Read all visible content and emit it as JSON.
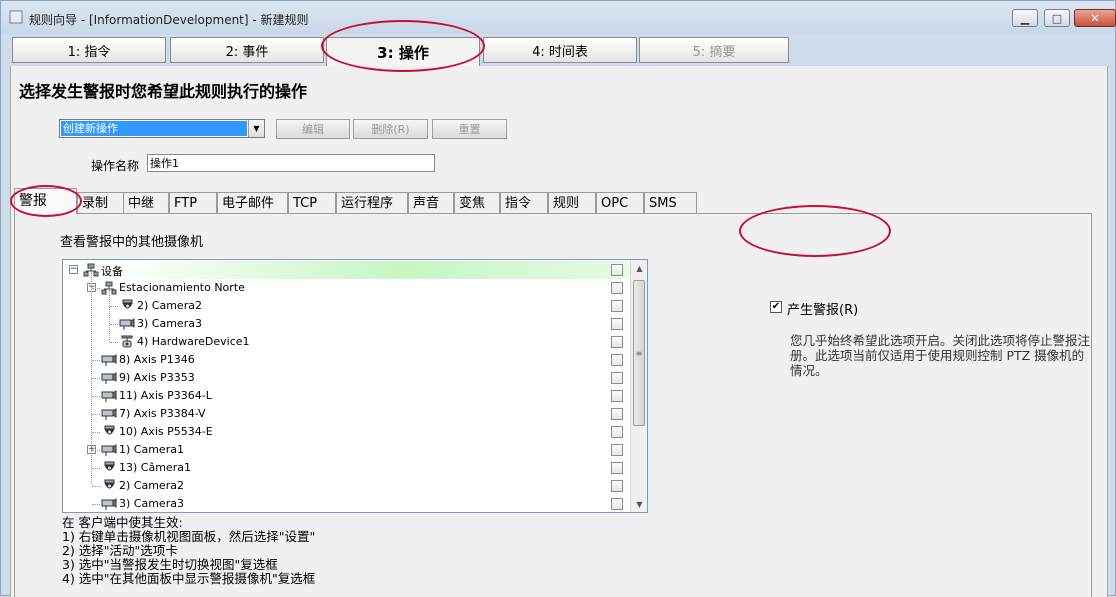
{
  "window": {
    "title": "规则向导 - [InformationDevelopment] - 新建规则",
    "minimize": "▁",
    "maximize": "□",
    "close": "✕"
  },
  "steps": [
    {
      "label": "1: 指令",
      "state": "normal"
    },
    {
      "label": "2: 事件",
      "state": "normal"
    },
    {
      "label": "3: 操作",
      "state": "active"
    },
    {
      "label": "4: 时间表",
      "state": "normal"
    },
    {
      "label": "5: 摘要",
      "state": "disabled"
    }
  ],
  "heading": "选择发生警报时您希望此规则执行的操作",
  "action_select": {
    "value": "创建新操作",
    "arrow": "▼"
  },
  "buttons": {
    "edit": "编辑",
    "delete": "删除(R)",
    "reset": "重置"
  },
  "action_name": {
    "label": "操作名称",
    "value": "操作1"
  },
  "subtabs": [
    "警报",
    "录制",
    "中继",
    "FTP",
    "电子邮件",
    "TCP",
    "运行程序",
    "声音",
    "变焦",
    "指令",
    "规则",
    "OPC",
    "SMS"
  ],
  "panel_title": "查看警报中的其他摄像机",
  "tree": [
    {
      "label": "设备",
      "level": 0,
      "icon": "network-devices-icon",
      "expander": "−"
    },
    {
      "label": "Estacionamiento Norte",
      "level": 1,
      "icon": "network-devices-icon",
      "expander": "−"
    },
    {
      "label": "2) Camera2",
      "level": 2,
      "icon": "dome-camera-icon"
    },
    {
      "label": "3) Camera3",
      "level": 2,
      "icon": "box-camera-icon"
    },
    {
      "label": "4) HardwareDevice1",
      "level": 2,
      "icon": "ptz-camera-icon"
    },
    {
      "label": "8) Axis P1346",
      "level": 1,
      "icon": "box-camera-icon"
    },
    {
      "label": "9) Axis P3353",
      "level": 1,
      "icon": "box-camera-icon"
    },
    {
      "label": "11) Axis P3364-L",
      "level": 1,
      "icon": "box-camera-icon"
    },
    {
      "label": "7) Axis P3384-V",
      "level": 1,
      "icon": "box-camera-icon"
    },
    {
      "label": "10) Axis P5534-E",
      "level": 1,
      "icon": "dome-camera-icon"
    },
    {
      "label": "1) Camera1",
      "level": 1,
      "icon": "box-camera-icon",
      "expander": "+"
    },
    {
      "label": "13) Câmera1",
      "level": 1,
      "icon": "dome-camera-icon"
    },
    {
      "label": "2) Camera2",
      "level": 1,
      "icon": "dome-camera-icon"
    },
    {
      "label": "3) Camera3",
      "level": 1,
      "icon": "box-camera-icon"
    }
  ],
  "scrollbar": {
    "up": "▲",
    "down": "▼",
    "grip": "≡"
  },
  "instructions": [
    "在  客户端中使其生效:",
    "1) 右键单击摄像机视图面板，然后选择\"设置\"",
    "2) 选择\"活动\"选项卡",
    "3) 选中\"当警报发生时切换视图\"复选框",
    "4) 选中\"在其他面板中显示警报摄像机\"复选框"
  ],
  "generate_alarm": {
    "label": "产生警报(R)",
    "checked": true,
    "check_mark": "✔",
    "description": "您几乎始终希望此选项开启。关闭此选项将停止警报注册。此选项当前仅适用于使用规则控制 PTZ 摄像机的情况。"
  },
  "colors": {
    "highlight": "#3399ff",
    "annotation": "#c8102e"
  }
}
